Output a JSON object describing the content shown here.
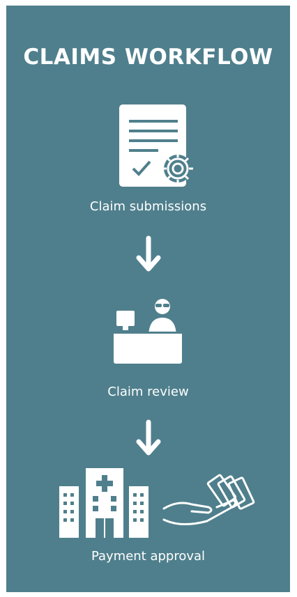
{
  "title": "CLAIMS WORKFLOW",
  "steps": [
    {
      "label": "Claim submissions",
      "icon": "document-gear-icon"
    },
    {
      "label": "Claim review",
      "icon": "reviewer-desk-icon"
    },
    {
      "label": "Payment approval",
      "icon": "hospital-payment-icon"
    }
  ],
  "colors": {
    "background": "#4f7f8c",
    "foreground": "#ffffff"
  }
}
